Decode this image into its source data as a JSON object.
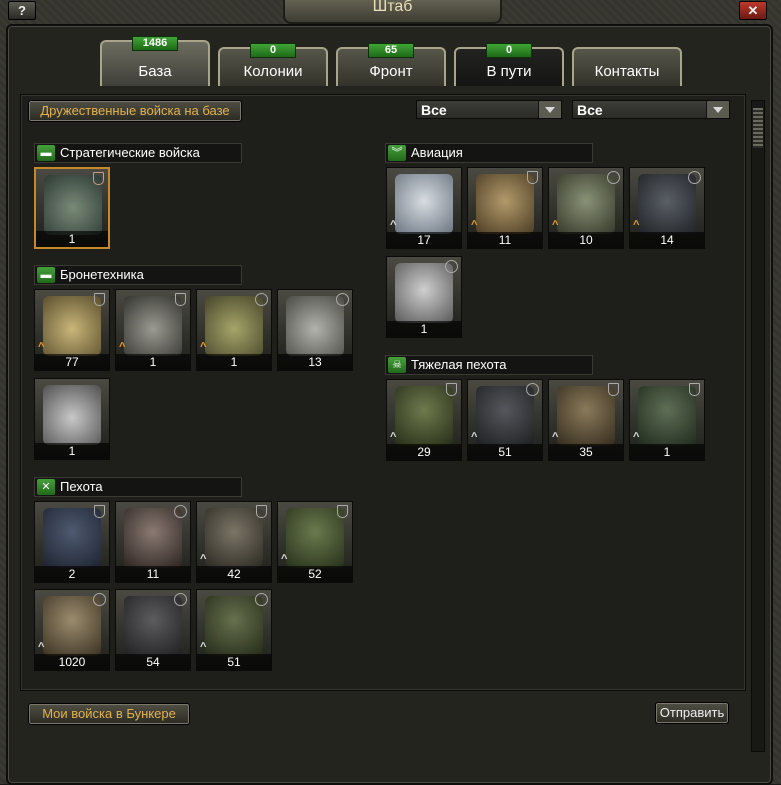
{
  "title": "Штаб",
  "help": "?",
  "close": "✕",
  "tabs": [
    {
      "label": "База",
      "count": "1486"
    },
    {
      "label": "Колонии",
      "count": "0"
    },
    {
      "label": "Фронт",
      "count": "65"
    },
    {
      "label": "В пути",
      "count": "0"
    },
    {
      "label": "Контакты"
    }
  ],
  "header_button": "Дружественные войска на базе",
  "filters": [
    "Все",
    "Все"
  ],
  "groups": [
    {
      "name": "Стратегические войска",
      "icon": "tank-icon",
      "units": [
        {
          "count": "1",
          "art": "strategic-vehicle"
        }
      ]
    },
    {
      "name": "Бронетехника",
      "icon": "tank-icon",
      "units": [
        {
          "count": "77",
          "art": "self-propelled-gun"
        },
        {
          "count": "1",
          "art": "apc"
        },
        {
          "count": "1",
          "art": "main-battle-tank"
        },
        {
          "count": "13",
          "art": "humvee"
        },
        {
          "count": "1",
          "art": "urban-camo-tank"
        }
      ]
    },
    {
      "name": "Пехота",
      "icon": "crossed-rifles-icon",
      "units": [
        {
          "count": "2"
        },
        {
          "count": "11"
        },
        {
          "count": "42"
        },
        {
          "count": "52"
        },
        {
          "count": "1020"
        },
        {
          "count": "54"
        },
        {
          "count": "51"
        }
      ]
    },
    {
      "name": "Авиация",
      "icon": "wings-icon",
      "units": [
        {
          "count": "17"
        },
        {
          "count": "11"
        },
        {
          "count": "10"
        },
        {
          "count": "14"
        },
        {
          "count": "1"
        }
      ]
    },
    {
      "name": "Тяжелая пехота",
      "icon": "skull-icon",
      "units": [
        {
          "count": "29"
        },
        {
          "count": "51"
        },
        {
          "count": "35"
        },
        {
          "count": "1"
        }
      ]
    }
  ],
  "footer": {
    "bunker": "Мои войска в Бункере",
    "send": "Отправить"
  }
}
